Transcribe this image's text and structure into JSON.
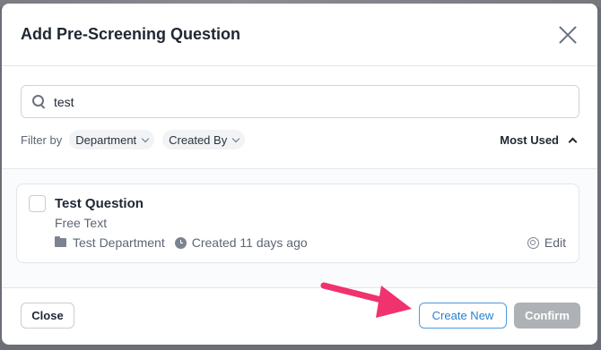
{
  "modal": {
    "title": "Add Pre-Screening Question"
  },
  "search": {
    "value": "test"
  },
  "filters": {
    "label": "Filter by",
    "chips": [
      "Department",
      "Created By"
    ],
    "sort_label": "Most Used"
  },
  "questions": [
    {
      "title": "Test Question",
      "type": "Free Text",
      "department": "Test Department",
      "created": "Created 11 days ago",
      "edit_label": "Edit"
    }
  ],
  "footer": {
    "close_label": "Close",
    "create_label": "Create New",
    "confirm_label": "Confirm"
  },
  "colors": {
    "accent": "#2b7fcc",
    "annotation_arrow": "#f0326e",
    "disabled_button": "#aeb1b5"
  }
}
